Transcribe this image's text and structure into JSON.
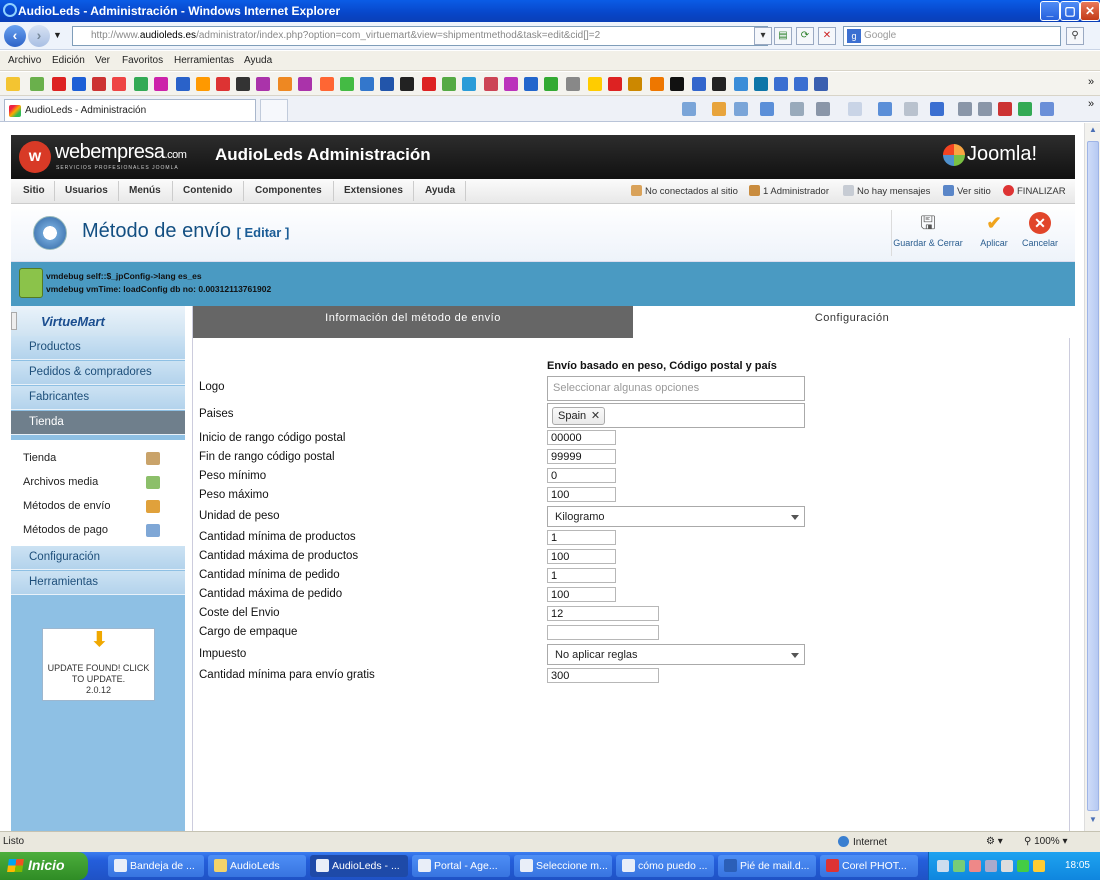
{
  "window": {
    "title": "AudioLeds - Administración - Windows Internet Explorer"
  },
  "browser": {
    "url_prefix": "http://www.",
    "url_domain": "audioleds.es",
    "url_rest": "/administrator/index.php?option=com_virtuemart&view=shipmentmethod&task=edit&cid[]=2",
    "search_placeholder": "Google",
    "menu": [
      "Archivo",
      "Edición",
      "Ver",
      "Favoritos",
      "Herramientas",
      "Ayuda"
    ],
    "tab_title": "AudioLeds - Administración",
    "status_left": "Listo",
    "status_zone": "Internet",
    "zoom": "100%"
  },
  "joomla": {
    "brand": "webempresa",
    "brand_suffix": ".com",
    "brand_sub": "SERVICIOS PROFESIONALES JOOMLA",
    "site_title": "AudioLeds Administración",
    "cms_logo": "Joomla!",
    "menu": [
      "Sitio",
      "Usuarios",
      "Menús",
      "Contenido",
      "Componentes",
      "Extensiones",
      "Ayuda"
    ],
    "status": {
      "offline_users": "No conectados al sitio",
      "admins": "1 Administrador",
      "messages": "No hay mensajes",
      "view_site": "Ver sitio",
      "logout": "FINALIZAR"
    },
    "page_title": "Método de envío",
    "page_title_suffix": "[ Editar ]",
    "toolbar": {
      "save_close": "Guardar & Cerrar",
      "apply": "Aplicar",
      "cancel": "Cancelar"
    },
    "debug": [
      "vmdebug self::$_jpConfig->lang es_es",
      "vmdebug vmTime: loadConfig db no: 0.00312113761902"
    ]
  },
  "sidebar": {
    "logo": "VirtueMart",
    "items_top": [
      "Productos",
      "Pedidos & compradores",
      "Fabricantes",
      "Tienda"
    ],
    "sub_items": [
      "Tienda",
      "Archivos media",
      "Métodos de envío",
      "Métodos de pago"
    ],
    "items_bottom": [
      "Configuración",
      "Herramientas"
    ],
    "update": "UPDATE FOUND! CLICK TO UPDATE.",
    "version": "2.0.12"
  },
  "form": {
    "tabs": [
      "Información del método de envío",
      "Configuración"
    ],
    "section_title": "Envío basado en peso, Código postal y país",
    "logo_label": "Logo",
    "logo_placeholder": "Seleccionar algunas opciones",
    "countries_label": "Paises",
    "country_chip": "Spain",
    "zip_start_label": "Inicio de rango código postal",
    "zip_start": "00000",
    "zip_end_label": "Fin de rango código postal",
    "zip_end": "99999",
    "weight_min_label": "Peso mínimo",
    "weight_min": "0",
    "weight_max_label": "Peso máximo",
    "weight_max": "100",
    "weight_unit_label": "Unidad de peso",
    "weight_unit": "Kilogramo",
    "products_min_label": "Cantidad mínima de productos",
    "products_min": "1",
    "products_max_label": "Cantidad máxima de productos",
    "products_max": "100",
    "order_min_label": "Cantidad mínima de pedido",
    "order_min": "1",
    "order_max_label": "Cantidad máxima de pedido",
    "order_max": "100",
    "cost_label": "Coste del Envio",
    "cost": "12",
    "package_fee_label": "Cargo de empaque",
    "package_fee": "",
    "tax_label": "Impuesto",
    "tax": "No aplicar reglas",
    "free_min_label": "Cantidad mínima para envío gratis",
    "free_min": "300"
  },
  "taskbar": {
    "start": "Inicio",
    "tasks": [
      "Bandeja de ...",
      "AudioLeds",
      "AudioLeds - ...",
      "Portal - Age...",
      "Seleccione m...",
      "cómo puedo ...",
      "Pié de mail.d...",
      "Corel PHOT..."
    ],
    "clock": "18:05"
  }
}
